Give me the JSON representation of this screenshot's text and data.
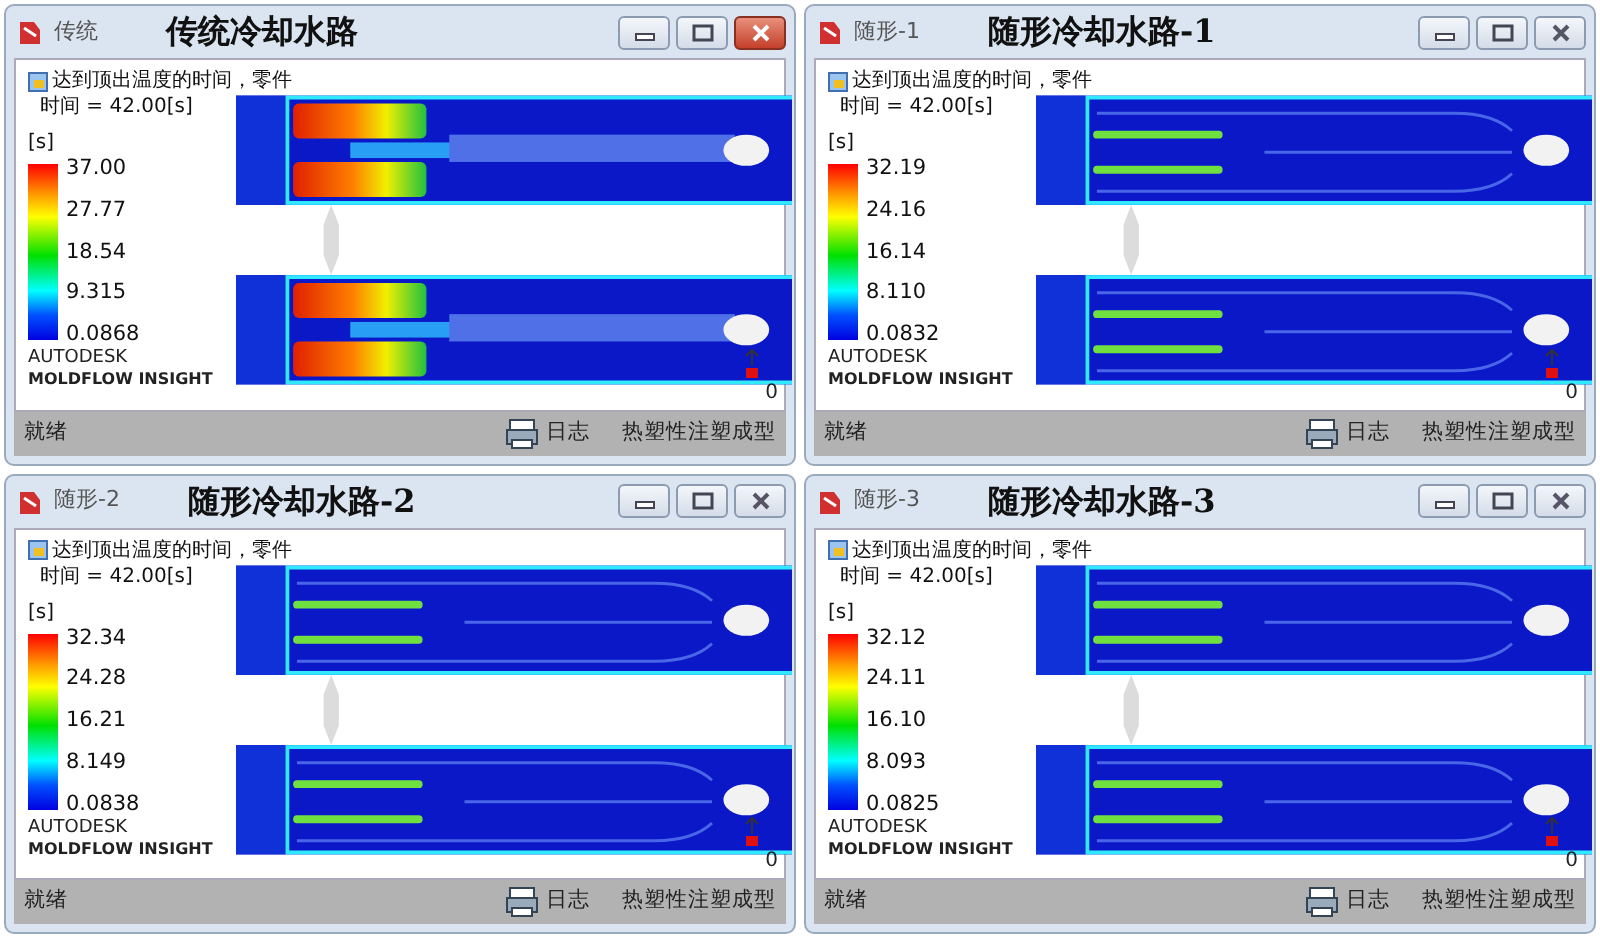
{
  "windows": [
    {
      "title": "传统",
      "caption": "传统冷却水路",
      "active": true,
      "kind": "conventional",
      "result_title": "达到顶出温度的时间，零件",
      "time": "时间 = 42.00[s]",
      "unit": "[s]",
      "legend": [
        "37.00",
        "27.77",
        "18.54",
        "9.315",
        "0.0868"
      ],
      "brand": "AUTODESK",
      "product": "MOLDFLOW INSIGHT",
      "axis_value": "0",
      "status": "就绪",
      "log": "日志",
      "mode": "热塑性注塑成型"
    },
    {
      "title": "随形-1",
      "caption": "随形冷却水路-1",
      "active": false,
      "kind": "conformal",
      "result_title": "达到顶出温度的时间，零件",
      "time": "时间 = 42.00[s]",
      "unit": "[s]",
      "legend": [
        "32.19",
        "24.16",
        "16.14",
        "8.110",
        "0.0832"
      ],
      "brand": "AUTODESK",
      "product": "MOLDFLOW INSIGHT",
      "axis_value": "0",
      "status": "就绪",
      "log": "日志",
      "mode": "热塑性注塑成型"
    },
    {
      "title": "随形-2",
      "caption": "随形冷却水路-2",
      "active": false,
      "kind": "conformal",
      "result_title": "达到顶出温度的时间，零件",
      "time": "时间 = 42.00[s]",
      "unit": "[s]",
      "legend": [
        "32.34",
        "24.28",
        "16.21",
        "8.149",
        "0.0838"
      ],
      "brand": "AUTODESK",
      "product": "MOLDFLOW INSIGHT",
      "axis_value": "0",
      "status": "就绪",
      "log": "日志",
      "mode": "热塑性注塑成型"
    },
    {
      "title": "随形-3",
      "caption": "随形冷却水路-3",
      "active": false,
      "kind": "conformal",
      "result_title": "达到顶出温度的时间，零件",
      "time": "时间 = 42.00[s]",
      "unit": "[s]",
      "legend": [
        "32.12",
        "24.11",
        "16.10",
        "8.093",
        "0.0825"
      ],
      "brand": "AUTODESK",
      "product": "MOLDFLOW INSIGHT",
      "axis_value": "0",
      "status": "就绪",
      "log": "日志",
      "mode": "热塑性注塑成型"
    }
  ]
}
